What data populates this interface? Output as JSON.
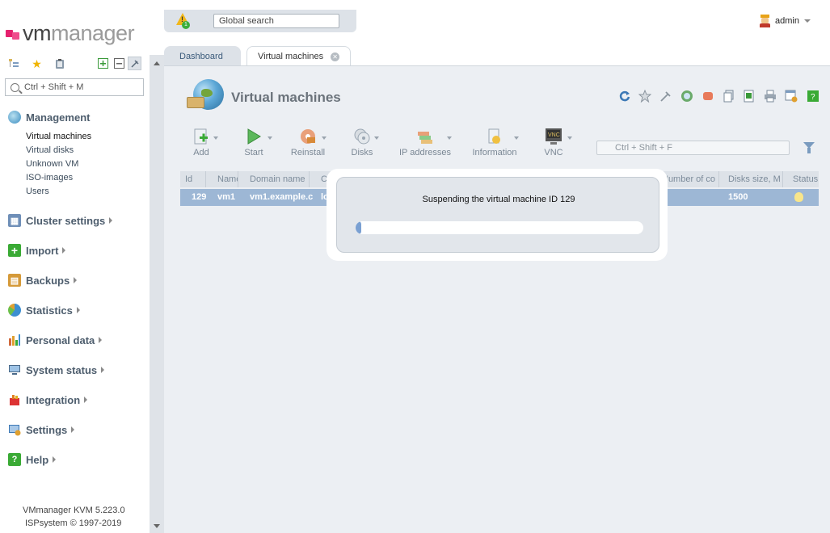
{
  "app": {
    "logo_vm": "vm",
    "logo_manager": "manager"
  },
  "topbar": {
    "global_search_placeholder": "Global search",
    "alert_count": "1"
  },
  "user": {
    "name": "admin"
  },
  "sidebar": {
    "search_placeholder": "Ctrl + Shift + M",
    "groups": [
      {
        "label": "Management",
        "icon": "globe-icon",
        "color": "#5fa052"
      },
      {
        "label": "Cluster settings",
        "icon": "cluster-icon",
        "color": "#5b7fb0"
      },
      {
        "label": "Import",
        "icon": "plus-icon",
        "color": "#3aaa35"
      },
      {
        "label": "Backups",
        "icon": "backups-icon",
        "color": "#c98b2b"
      },
      {
        "label": "Statistics",
        "icon": "pie-chart-icon",
        "color": "#3c8fd1"
      },
      {
        "label": "Personal data",
        "icon": "bar-chart-icon",
        "color": "#d16a3c"
      },
      {
        "label": "System status",
        "icon": "monitor-icon",
        "color": "#4a6a8a"
      },
      {
        "label": "Integration",
        "icon": "integration-icon",
        "color": "#d33"
      },
      {
        "label": "Settings",
        "icon": "settings-icon",
        "color": "#3c78b5"
      },
      {
        "label": "Help",
        "icon": "help-icon",
        "color": "#3aaa35"
      }
    ],
    "management_items": [
      "Virtual machines",
      "Virtual disks",
      "Unknown VM",
      "ISO-images",
      "Users"
    ],
    "footer_version": "VMmanager KVM 5.223.0",
    "footer_copyright": "ISPsystem © 1997-2019"
  },
  "tabs": [
    {
      "label": "Dashboard"
    },
    {
      "label": "Virtual machines"
    }
  ],
  "page": {
    "title": "Virtual machines"
  },
  "toolbar": {
    "buttons": [
      "Add",
      "Start",
      "Reinstall",
      "Disks",
      "IP addresses",
      "Information",
      "VNC"
    ],
    "search_placeholder": "Ctrl + Shift + F"
  },
  "table": {
    "headers": [
      "Id",
      "Name",
      "Domain name",
      "C",
      "Number of co",
      "Disks size, M",
      "Status"
    ],
    "row": {
      "id": "129",
      "name": "vm1",
      "domain": "vm1.example.c",
      "c": "lo",
      "disks": "1500"
    }
  },
  "dialog": {
    "message": "Suspending the virtual machine ID 129",
    "progress": 0.02
  },
  "colors": {
    "accent": "#9db7d5",
    "panel": "#eceff3"
  }
}
